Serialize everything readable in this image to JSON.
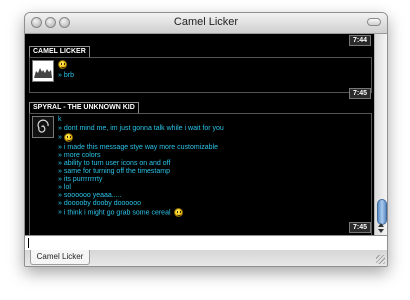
{
  "window": {
    "title": "Camel Licker"
  },
  "chat": {
    "messages": [
      {
        "sender": "CAMEL LICKER",
        "top_timestamp": "7:44",
        "timestamp": "7:45",
        "avatar": "dromedary-icon",
        "lines": [
          {
            "text": "",
            "emoji": "smiley-emoji"
          },
          {
            "text": "brb",
            "emoji": ""
          }
        ]
      },
      {
        "sender": "SPYRAL - THE UNKNOWN KID",
        "timestamp": "7:45",
        "avatar": "spiral-icon",
        "lines": [
          {
            "text": "k",
            "emoji": ""
          },
          {
            "text": "dont mind me, im just gonna talk while i wait for you",
            "emoji": ""
          },
          {
            "text": "",
            "emoji": "smiley-emoji"
          },
          {
            "text": "i made this message stye way more customizable",
            "emoji": ""
          },
          {
            "text": "more colors",
            "emoji": ""
          },
          {
            "text": "ability to turn user icons on and off",
            "emoji": ""
          },
          {
            "text": "same for turning off the timestamp",
            "emoji": ""
          },
          {
            "text": "its purrrrrrrty",
            "emoji": ""
          },
          {
            "text": "lol",
            "emoji": ""
          },
          {
            "text": "soooooo yeaaa.....",
            "emoji": ""
          },
          {
            "text": "dooooby dooby doooooo",
            "emoji": ""
          },
          {
            "text": "i think i might go grab some cereal",
            "emoji": "smiley-emoji"
          }
        ]
      }
    ]
  },
  "input": {
    "value": ""
  },
  "tabs": [
    {
      "label": "Camel Licker"
    }
  ],
  "colors": {
    "chat_background": "#000000",
    "message_text": "#2ac4e8",
    "scroll_thumb": "#5d8bc3"
  }
}
